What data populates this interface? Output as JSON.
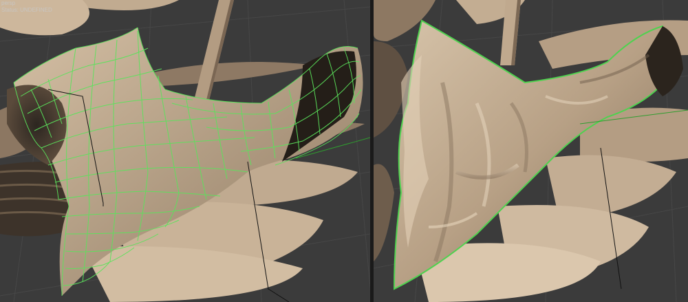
{
  "viewports": {
    "left": {
      "mode": "wireframe-retopology",
      "hud_line1": "persp",
      "hud_line2": "Status: UNDEFINED",
      "wire_color": "#5be35b"
    },
    "right": {
      "mode": "sculpted-detail",
      "outline_color": "#4fd24f"
    }
  },
  "colors": {
    "background": "#3b3b3b",
    "grid": "#4a4a4a",
    "clay": "#b49c80",
    "clay_dark": "#6f5e4c",
    "clay_light": "#d9c6ad"
  }
}
